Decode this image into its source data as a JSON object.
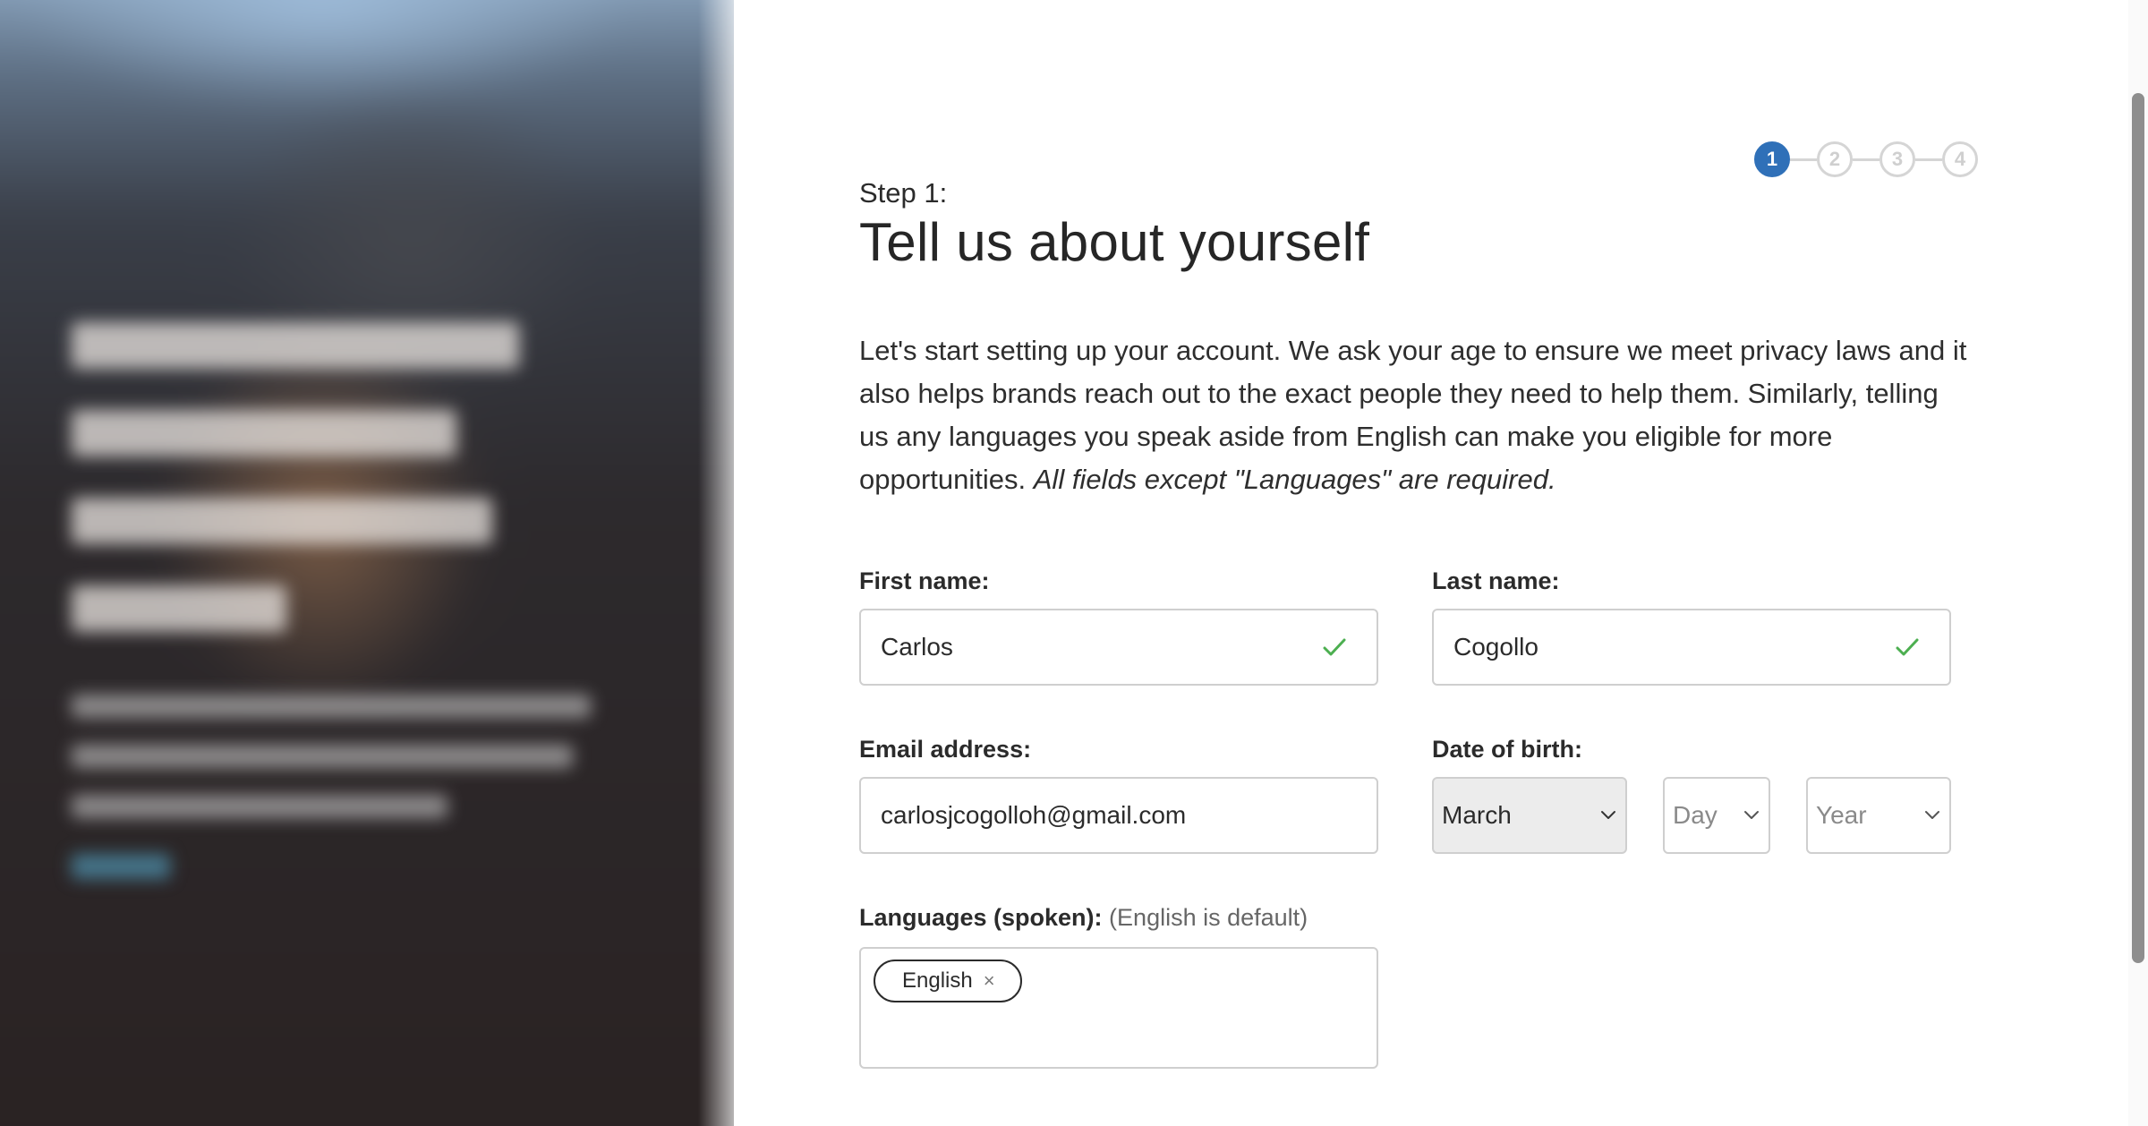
{
  "nav": {
    "items": [
      "",
      ""
    ]
  },
  "stepper": {
    "steps": [
      "1",
      "2",
      "3",
      "4"
    ],
    "active": 1
  },
  "header": {
    "step_label": "Step 1:",
    "title": "Tell us about yourself"
  },
  "intro": {
    "text": "Let's start setting up your account. We ask your age to ensure we meet privacy laws and it also helps brands reach out to the exact people they need to help them. Similarly, telling us any languages you speak aside from English can make you eligible for more opportunities.",
    "emphasis": "All fields except \"Languages\" are required."
  },
  "form": {
    "first_name": {
      "label": "First name:",
      "value": "Carlos",
      "valid": true
    },
    "last_name": {
      "label": "Last name:",
      "value": "Cogollo",
      "valid": true
    },
    "email": {
      "label": "Email address:",
      "value": "carlosjcogolloh@gmail.com"
    },
    "dob": {
      "label": "Date of birth:",
      "month": "March",
      "day_placeholder": "Day",
      "year_placeholder": "Year"
    },
    "languages": {
      "label": "Languages (spoken):",
      "hint": "(English is default)",
      "tags": [
        "English"
      ]
    }
  },
  "icons": {
    "valid": "check-icon",
    "dropdown": "chevron-down-icon",
    "remove_tag": "close-icon"
  },
  "colors": {
    "accent": "#2f70b8",
    "valid": "#4caf50",
    "border": "#cfcfcf"
  }
}
